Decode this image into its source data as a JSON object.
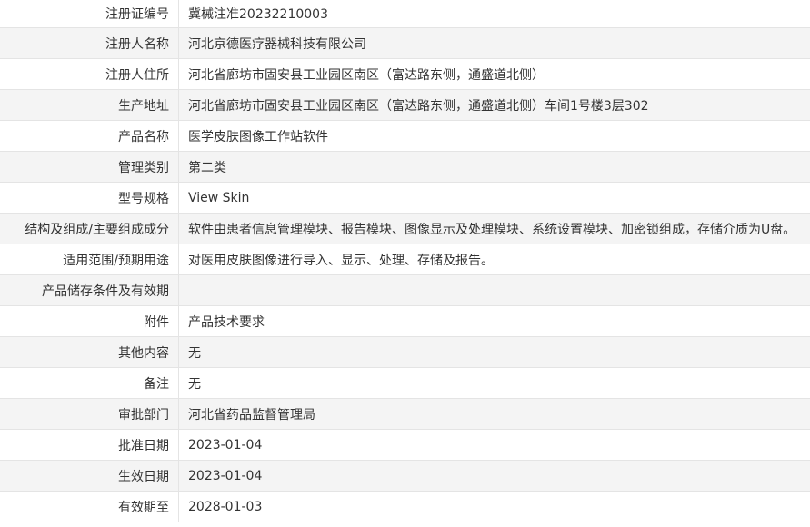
{
  "record": {
    "rows": [
      {
        "label": "注册证编号",
        "value": "冀械注准20232210003"
      },
      {
        "label": "注册人名称",
        "value": "河北京德医疗器械科技有限公司"
      },
      {
        "label": "注册人住所",
        "value": "河北省廊坊市固安县工业园区南区（富达路东侧，通盛道北侧）"
      },
      {
        "label": "生产地址",
        "value": "河北省廊坊市固安县工业园区南区（富达路东侧，通盛道北侧）车间1号楼3层302"
      },
      {
        "label": "产品名称",
        "value": "医学皮肤图像工作站软件"
      },
      {
        "label": "管理类别",
        "value": "第二类"
      },
      {
        "label": "型号规格",
        "value": "View Skin"
      },
      {
        "label": "结构及组成/主要组成成分",
        "value": "软件由患者信息管理模块、报告模块、图像显示及处理模块、系统设置模块、加密锁组成，存储介质为U盘。"
      },
      {
        "label": "适用范围/预期用途",
        "value": "对医用皮肤图像进行导入、显示、处理、存储及报告。"
      },
      {
        "label": "产品储存条件及有效期",
        "value": ""
      },
      {
        "label": "附件",
        "value": "产品技术要求"
      },
      {
        "label": "其他内容",
        "value": "无"
      },
      {
        "label": "备注",
        "value": "无"
      },
      {
        "label": "审批部门",
        "value": "河北省药品监督管理局"
      },
      {
        "label": "批准日期",
        "value": "2023-01-04"
      },
      {
        "label": "生效日期",
        "value": "2023-01-04"
      },
      {
        "label": "有效期至",
        "value": "2028-01-03"
      }
    ]
  }
}
